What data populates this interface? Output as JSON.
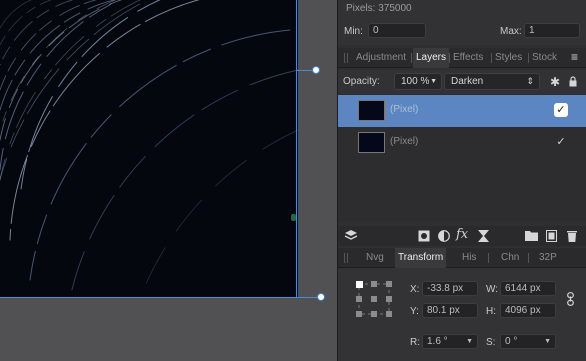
{
  "info": {
    "pixels": "Pixels: 375000",
    "min_label": "Min:",
    "min_value": "0",
    "max_label": "Max:",
    "max_value": "1"
  },
  "tabs": [
    {
      "label": "Adjustment"
    },
    {
      "label": "Layers"
    },
    {
      "label": "Effects"
    },
    {
      "label": "Styles"
    },
    {
      "label": "Stock"
    }
  ],
  "layers_panel": {
    "opacity_label": "Opacity:",
    "opacity_value": "100 %",
    "blend_mode": "Darken",
    "layers": [
      {
        "name": "(Pixel)",
        "selected": true,
        "visible": true
      },
      {
        "name": "(Pixel)",
        "selected": false,
        "visible": true
      }
    ]
  },
  "bottom_tabs": [
    {
      "label": "Nvg"
    },
    {
      "label": "Transform"
    },
    {
      "label": "His"
    },
    {
      "label": "Chn"
    },
    {
      "label": "32P"
    }
  ],
  "transform": {
    "x_label": "X:",
    "x_value": "-33.8 px",
    "y_label": "Y:",
    "y_value": "80.1 px",
    "w_label": "W:",
    "w_value": "6144 px",
    "h_label": "H:",
    "h_value": "4096 px",
    "r_label": "R:",
    "r_value": "1.6 °",
    "s_label": "S:",
    "s_value": "0 °"
  },
  "colors": {
    "selection": "#3b82d6",
    "selected_row": "#5b86c2",
    "panel_bg": "#2f2f31"
  }
}
